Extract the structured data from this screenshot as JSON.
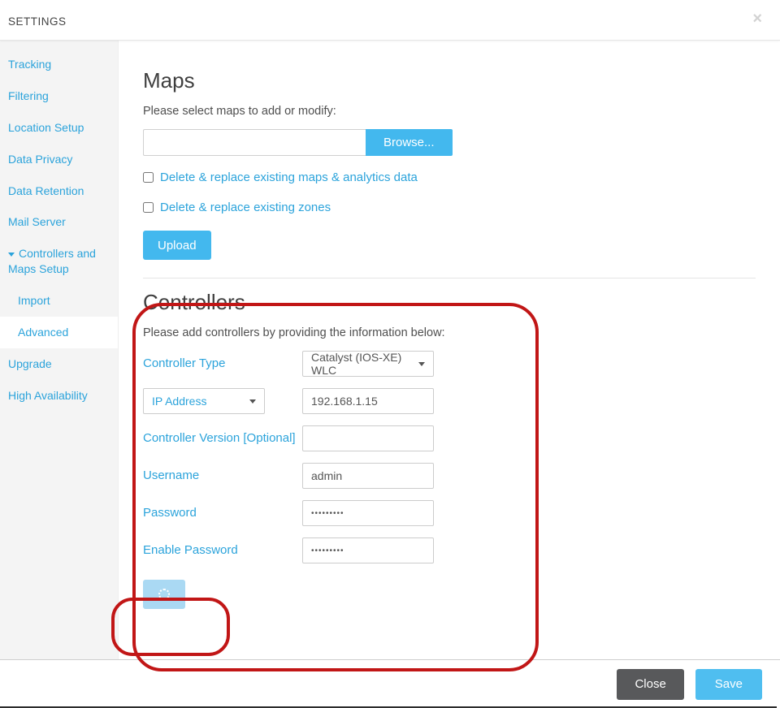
{
  "header": {
    "title": "SETTINGS"
  },
  "sidebar": {
    "items": [
      {
        "label": "Tracking"
      },
      {
        "label": "Filtering"
      },
      {
        "label": "Location Setup"
      },
      {
        "label": "Data Privacy"
      },
      {
        "label": "Data Retention"
      },
      {
        "label": "Mail Server"
      },
      {
        "label": "Controllers and Maps Setup",
        "expanded": true
      },
      {
        "label": "Import",
        "sub": true
      },
      {
        "label": "Advanced",
        "sub": true,
        "active": true
      },
      {
        "label": "Upgrade"
      },
      {
        "label": "High Availability"
      }
    ]
  },
  "maps": {
    "title": "Maps",
    "desc": "Please select maps to add or modify:",
    "browse": "Browse...",
    "opt_replace_maps": "Delete & replace existing maps & analytics data",
    "opt_replace_zones": "Delete & replace existing zones",
    "upload": "Upload"
  },
  "controllers": {
    "title": "Controllers",
    "desc": "Please add controllers by providing the information below:",
    "fields": {
      "type_label": "Controller Type",
      "type_value": "Catalyst (IOS-XE) WLC",
      "ip_mode": "IP Address",
      "ip_value": "192.168.1.15",
      "version_label": "Controller Version [Optional]",
      "version_value": "",
      "username_label": "Username",
      "username_value": "admin",
      "password_label": "Password",
      "password_mask": "•••••••••",
      "enable_label": "Enable Password",
      "enable_mask": "•••••••••"
    }
  },
  "footer": {
    "close": "Close",
    "save": "Save"
  }
}
